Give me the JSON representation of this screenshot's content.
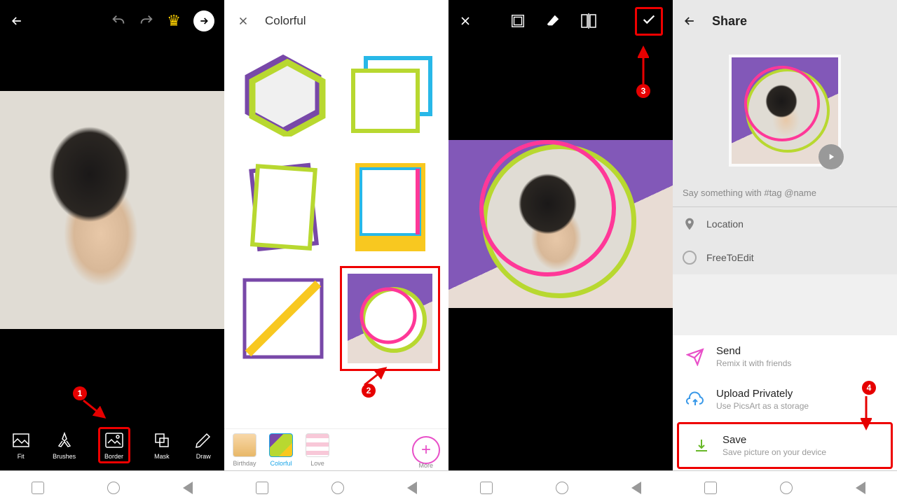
{
  "screen1": {
    "tools": [
      "Fit",
      "Brushes",
      "Border",
      "Mask",
      "Draw"
    ],
    "marker": "1"
  },
  "screen2": {
    "title": "Colorful",
    "cats": [
      "Birthday",
      "Colorful",
      "Love"
    ],
    "more": "More",
    "marker": "2"
  },
  "screen3": {
    "marker": "3"
  },
  "screen4": {
    "title": "Share",
    "placeholder": "Say something with #tag @name",
    "location": "Location",
    "free": "FreeToEdit",
    "actions": [
      {
        "title": "Send",
        "sub": "Remix it with friends"
      },
      {
        "title": "Upload Privately",
        "sub": "Use PicsArt as a storage"
      },
      {
        "title": "Save",
        "sub": "Save picture on your device"
      }
    ],
    "marker": "4"
  }
}
